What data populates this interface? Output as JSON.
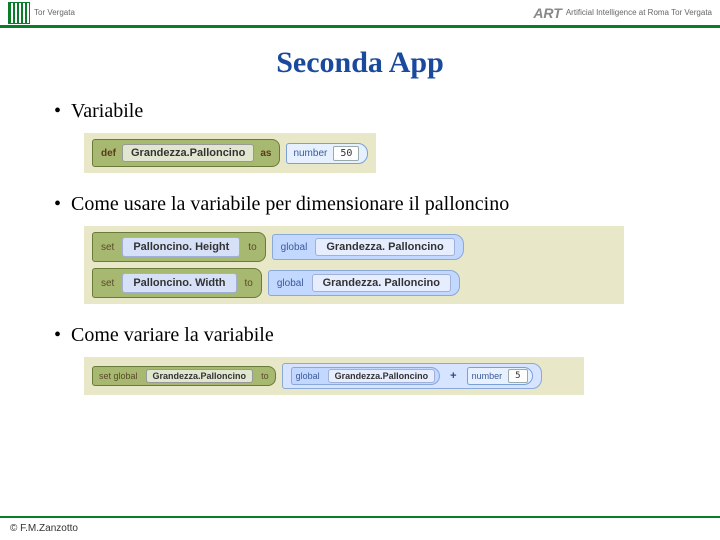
{
  "header": {
    "left_label": "Tor Vergata",
    "right_label": "Artificial Intelligence\nat Roma Tor Vergata",
    "right_logo": "ART"
  },
  "title": "Seconda App",
  "section1": {
    "bullet": "Variabile",
    "def_kw": "def",
    "var_name": "Grandezza.Palloncino",
    "as_label": "as",
    "num_kw": "number",
    "num_value": "50"
  },
  "section2": {
    "bullet": "Come usare la variabile per dimensionare il palloncino",
    "rows": [
      {
        "set_kw": "set",
        "prop": "Palloncino. Height",
        "to_kw": "to",
        "global_kw": "global",
        "var": "Grandezza. Palloncino"
      },
      {
        "set_kw": "set",
        "prop": "Palloncino. Width",
        "to_kw": "to",
        "global_kw": "global",
        "var": "Grandezza. Palloncino"
      }
    ]
  },
  "section3": {
    "bullet": "Come variare la variabile",
    "set_kw": "set global",
    "target_var": "Grandezza.Palloncino",
    "to_kw": "to",
    "global_kw": "global",
    "lhs_var": "Grandezza.Palloncino",
    "op": "+",
    "num_kw": "number",
    "num_value": "5"
  },
  "footer": "© F.M.Zanzotto"
}
